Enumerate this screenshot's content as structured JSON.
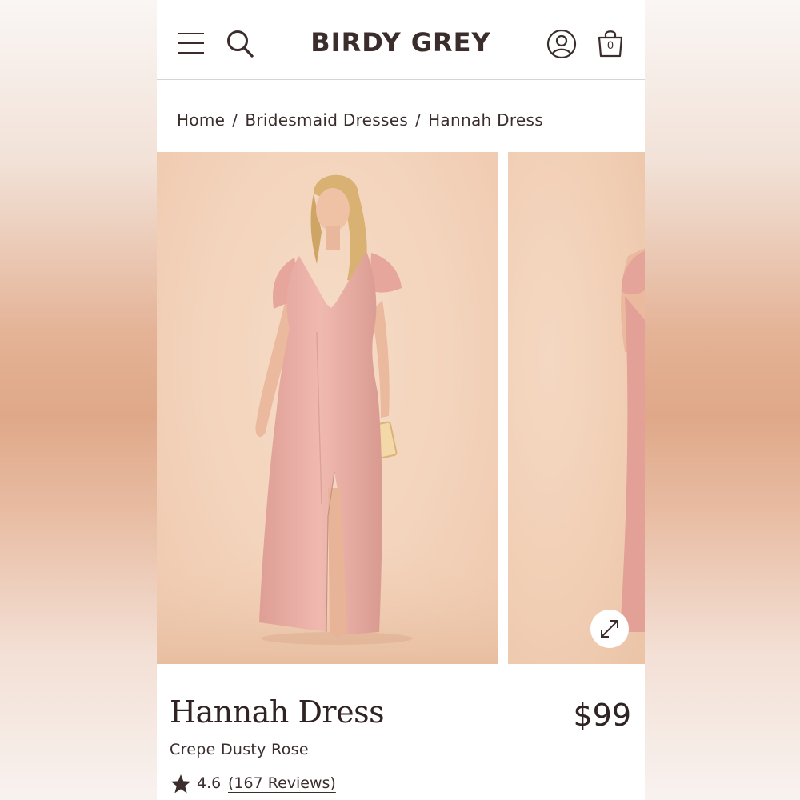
{
  "header": {
    "logo": "BIRDY GREY",
    "bag_count": "0",
    "icons": [
      "menu-icon",
      "search-icon",
      "account-icon",
      "bag-icon"
    ]
  },
  "breadcrumb": {
    "items": [
      "Home",
      "Bridesmaid Dresses",
      "Hannah Dress"
    ],
    "separator": "/"
  },
  "gallery": {
    "expand_icon": "expand-icon"
  },
  "product": {
    "title": "Hannah Dress",
    "price": "$99",
    "color": "Crepe Dusty Rose",
    "rating": "4.6",
    "reviews": "(167 Reviews)"
  },
  "colors": {
    "text": "#3a2d2c",
    "dress": "#e9aea4",
    "backdrop": "#f3d3bb"
  }
}
